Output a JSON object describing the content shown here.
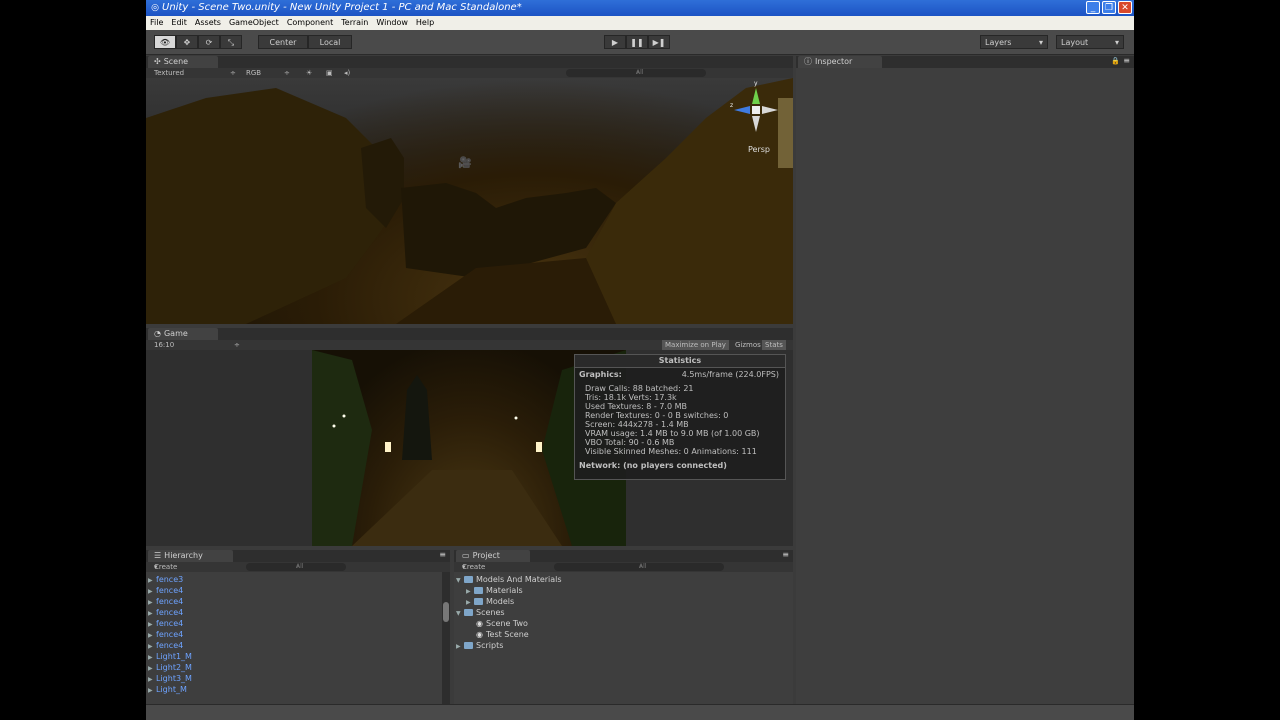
{
  "window": {
    "title": "Unity - Scene Two.unity - New Unity Project 1 - PC and Mac Standalone*"
  },
  "menubar": [
    "File",
    "Edit",
    "Assets",
    "GameObject",
    "Component",
    "Terrain",
    "Window",
    "Help"
  ],
  "toolbar": {
    "pivot_center": "Center",
    "pivot_local": "Local",
    "layers": "Layers",
    "layout": "Layout"
  },
  "scene": {
    "tab": "Scene",
    "render_mode": "Textured",
    "color_mode": "RGB",
    "search": "All",
    "persp": "Persp",
    "axis_y": "y",
    "axis_z": "z"
  },
  "game": {
    "tab": "Game",
    "aspect": "16:10",
    "maximize": "Maximize on Play",
    "gizmos": "Gizmos",
    "stats": "Stats"
  },
  "statistics": {
    "title": "Statistics",
    "graphics_label": "Graphics:",
    "graphics_value": "4.5ms/frame (224.0FPS)",
    "lines": [
      "Draw Calls: 88     batched: 21",
      "Tris: 18.1k   Verts: 17.3k",
      "Used Textures: 8 - 7.0 MB",
      "Render Textures: 0 - 0 B   switches: 0",
      "Screen: 444x278 - 1.4 MB",
      "VRAM usage: 1.4 MB to 9.0 MB (of 1.00 GB)",
      "VBO Total: 90 - 0.6 MB",
      "Visible Skinned Meshes: 0      Animations: 111"
    ],
    "network": "Network: (no players connected)"
  },
  "inspector": {
    "tab": "Inspector"
  },
  "hierarchy": {
    "tab": "Hierarchy",
    "create": "Create",
    "search": "All",
    "items": [
      "fence3",
      "fence4",
      "fence4",
      "fence4",
      "fence4",
      "fence4",
      "fence4",
      "Light1_M",
      "Light2_M",
      "Light3_M",
      "Light_M"
    ]
  },
  "project": {
    "tab": "Project",
    "create": "Create",
    "search": "All",
    "tree": [
      {
        "label": "Models And Materials",
        "level": 0,
        "kind": "folder",
        "expanded": true
      },
      {
        "label": "Materials",
        "level": 1,
        "kind": "folder",
        "expanded": false
      },
      {
        "label": "Models",
        "level": 1,
        "kind": "folder",
        "expanded": false
      },
      {
        "label": "Scenes",
        "level": 0,
        "kind": "folder",
        "expanded": true
      },
      {
        "label": "Scene Two",
        "level": 1,
        "kind": "scene",
        "expanded": false
      },
      {
        "label": "Test Scene",
        "level": 1,
        "kind": "scene",
        "expanded": false
      },
      {
        "label": "Scripts",
        "level": 0,
        "kind": "folder",
        "expanded": false
      }
    ]
  }
}
